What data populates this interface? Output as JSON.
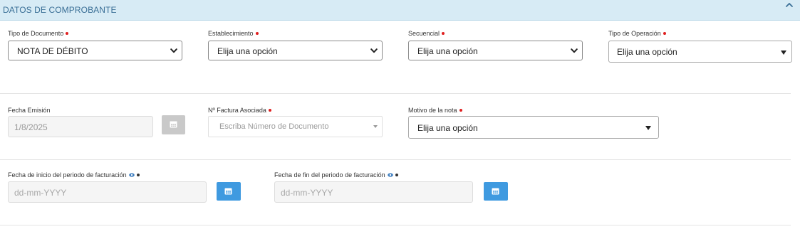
{
  "section": {
    "title": "DATOS DE COMPROBANTE",
    "collapse_icon": "chevron-up-icon"
  },
  "row1": {
    "tipo_documento": {
      "label": "Tipo de Documento",
      "value": "NOTA DE DÉBITO",
      "required": true
    },
    "establecimiento": {
      "label": "Establecimiento",
      "value": "Elija una opción",
      "required": true
    },
    "secuencial": {
      "label": "Secuencial",
      "value": "Elija una opción",
      "required": true
    },
    "tipo_operacion": {
      "label": "Tipo de Operación",
      "value": "Elija una opción",
      "required": true
    }
  },
  "row2": {
    "fecha_emision": {
      "label": "Fecha Emisión",
      "value": "1/8/2025",
      "calendar_icon": "calendar-icon",
      "disabled": true
    },
    "factura_asociada": {
      "label": "Nº Factura Asociada",
      "placeholder": "Escriba Número de Documento",
      "required": true
    },
    "motivo": {
      "label": "Motivo de la nota",
      "value": "Elija una opción",
      "required": true
    }
  },
  "row3": {
    "fecha_inicio": {
      "label": "Fecha de inicio del periodo de facturación",
      "placeholder": "dd-mm-YYYY",
      "info_icon": "eye-icon",
      "calendar_icon": "calendar-icon"
    },
    "fecha_fin": {
      "label": "Fecha de fin del periodo de facturación",
      "placeholder": "dd-mm-YYYY",
      "info_icon": "eye-icon",
      "calendar_icon": "calendar-icon"
    }
  },
  "colors": {
    "header_bg": "#d7ebf5",
    "header_text": "#3a6f96",
    "required_dot": "#e02020",
    "calendar_button": "#3f9ae0",
    "calendar_button_disabled": "#c9c9c9"
  }
}
